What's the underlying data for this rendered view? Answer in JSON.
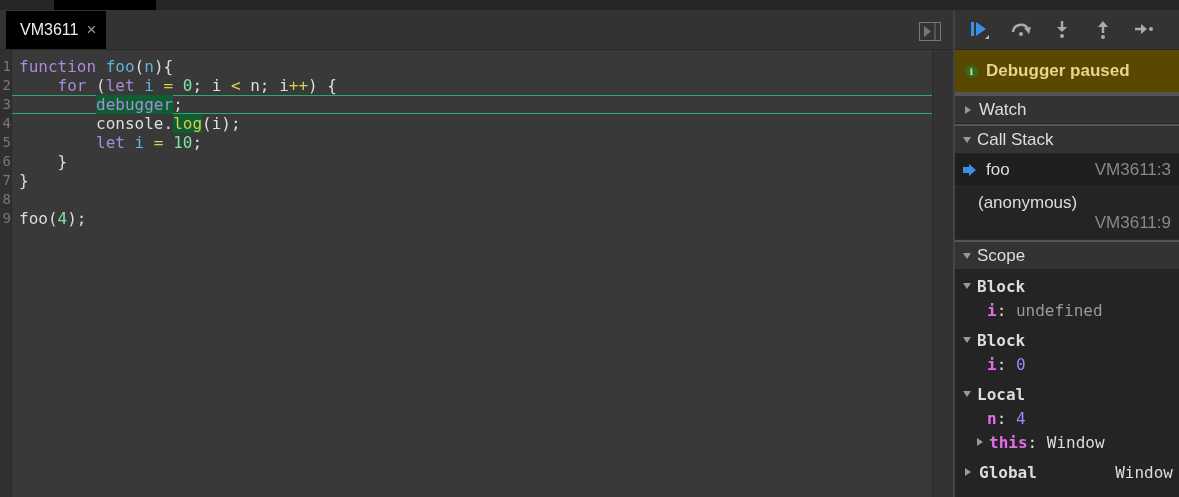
{
  "tabs": [
    {
      "label": "VM3611",
      "close": "×",
      "selected": true
    }
  ],
  "editor": {
    "lines": [
      {
        "number": "1",
        "current": false,
        "tokens": [
          {
            "text": "function ",
            "kind": "keyword"
          },
          {
            "text": "foo",
            "kind": "def"
          },
          {
            "text": "(",
            "kind": "plain"
          },
          {
            "text": "n",
            "kind": "def"
          },
          {
            "text": "){",
            "kind": "plain"
          }
        ]
      },
      {
        "number": "2",
        "current": false,
        "tokens": [
          {
            "text": "    for",
            "kind": "keyword"
          },
          {
            "text": " (",
            "kind": "plain"
          },
          {
            "text": "let ",
            "kind": "keyword"
          },
          {
            "text": "i ",
            "kind": "def"
          },
          {
            "text": "= ",
            "kind": "operator"
          },
          {
            "text": "0",
            "kind": "number"
          },
          {
            "text": "; i ",
            "kind": "plain"
          },
          {
            "text": "<",
            "kind": "operator"
          },
          {
            "text": " n; i",
            "kind": "plain"
          },
          {
            "text": "++",
            "kind": "operator"
          },
          {
            "text": ") {",
            "kind": "plain"
          }
        ]
      },
      {
        "number": "3",
        "current": true,
        "tokens": [
          {
            "text": "        debugger",
            "kind": "keyword",
            "highlighted": true
          },
          {
            "text": ";",
            "kind": "plain"
          }
        ]
      },
      {
        "number": "4",
        "current": false,
        "tokens": [
          {
            "text": "        console.",
            "kind": "plain"
          },
          {
            "text": "log",
            "kind": "property",
            "highlighted": true
          },
          {
            "text": "(i);",
            "kind": "plain"
          }
        ]
      },
      {
        "number": "5",
        "current": false,
        "tokens": [
          {
            "text": "        let ",
            "kind": "keyword"
          },
          {
            "text": "i ",
            "kind": "def"
          },
          {
            "text": "= ",
            "kind": "operator"
          },
          {
            "text": "10",
            "kind": "number"
          },
          {
            "text": ";",
            "kind": "plain"
          }
        ]
      },
      {
        "number": "6",
        "current": false,
        "tokens": [
          {
            "text": "    }",
            "kind": "plain"
          }
        ]
      },
      {
        "number": "7",
        "current": false,
        "tokens": [
          {
            "text": "}",
            "kind": "plain"
          }
        ]
      },
      {
        "number": "8",
        "current": false
      },
      {
        "number": "9",
        "current": false,
        "tokens": [
          {
            "text": "foo(",
            "kind": "plain"
          },
          {
            "text": "4",
            "kind": "number"
          },
          {
            "text": ");",
            "kind": "plain"
          }
        ]
      }
    ]
  },
  "status": {
    "icon": "i",
    "text": "Debugger paused"
  },
  "sections": [
    {
      "kind": "watch",
      "title": "Watch",
      "expanded": false
    },
    {
      "kind": "callstack",
      "title": "Call Stack",
      "expanded": true,
      "frames": [
        {
          "name": "foo",
          "location": "VM3611:3",
          "selected": true
        },
        {
          "name": "(anonymous)",
          "location": "VM3611:9",
          "selected": false
        }
      ]
    },
    {
      "kind": "scope",
      "title": "Scope",
      "expanded": true,
      "scopes": [
        {
          "name": "Block",
          "expanded": true,
          "vars": [
            {
              "name": "i",
              "separator": ":",
              "value": "undefined",
              "kind": "undefined"
            }
          ]
        },
        {
          "name": "Block",
          "expanded": true,
          "vars": [
            {
              "name": "i",
              "separator": ":",
              "value": "0",
              "kind": "number"
            }
          ]
        },
        {
          "name": "Local",
          "expanded": true,
          "vars": [
            {
              "name": "n",
              "separator": ":",
              "value": "4",
              "kind": "number"
            },
            {
              "name": "this",
              "separator": ":",
              "value": "Window",
              "kind": "object",
              "expanded": false
            }
          ]
        },
        {
          "name": "Global",
          "expanded": false,
          "value": "Window"
        }
      ]
    }
  ]
}
